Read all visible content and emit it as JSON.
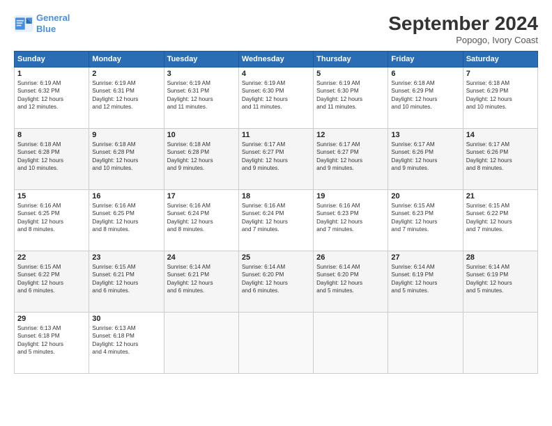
{
  "header": {
    "logo_line1": "General",
    "logo_line2": "Blue",
    "month": "September 2024",
    "location": "Popogo, Ivory Coast"
  },
  "weekdays": [
    "Sunday",
    "Monday",
    "Tuesday",
    "Wednesday",
    "Thursday",
    "Friday",
    "Saturday"
  ],
  "weeks": [
    [
      {
        "day": "1",
        "lines": [
          "Sunrise: 6:19 AM",
          "Sunset: 6:32 PM",
          "Daylight: 12 hours",
          "and 12 minutes."
        ]
      },
      {
        "day": "2",
        "lines": [
          "Sunrise: 6:19 AM",
          "Sunset: 6:31 PM",
          "Daylight: 12 hours",
          "and 12 minutes."
        ]
      },
      {
        "day": "3",
        "lines": [
          "Sunrise: 6:19 AM",
          "Sunset: 6:31 PM",
          "Daylight: 12 hours",
          "and 11 minutes."
        ]
      },
      {
        "day": "4",
        "lines": [
          "Sunrise: 6:19 AM",
          "Sunset: 6:30 PM",
          "Daylight: 12 hours",
          "and 11 minutes."
        ]
      },
      {
        "day": "5",
        "lines": [
          "Sunrise: 6:19 AM",
          "Sunset: 6:30 PM",
          "Daylight: 12 hours",
          "and 11 minutes."
        ]
      },
      {
        "day": "6",
        "lines": [
          "Sunrise: 6:18 AM",
          "Sunset: 6:29 PM",
          "Daylight: 12 hours",
          "and 10 minutes."
        ]
      },
      {
        "day": "7",
        "lines": [
          "Sunrise: 6:18 AM",
          "Sunset: 6:29 PM",
          "Daylight: 12 hours",
          "and 10 minutes."
        ]
      }
    ],
    [
      {
        "day": "8",
        "lines": [
          "Sunrise: 6:18 AM",
          "Sunset: 6:28 PM",
          "Daylight: 12 hours",
          "and 10 minutes."
        ]
      },
      {
        "day": "9",
        "lines": [
          "Sunrise: 6:18 AM",
          "Sunset: 6:28 PM",
          "Daylight: 12 hours",
          "and 10 minutes."
        ]
      },
      {
        "day": "10",
        "lines": [
          "Sunrise: 6:18 AM",
          "Sunset: 6:28 PM",
          "Daylight: 12 hours",
          "and 9 minutes."
        ]
      },
      {
        "day": "11",
        "lines": [
          "Sunrise: 6:17 AM",
          "Sunset: 6:27 PM",
          "Daylight: 12 hours",
          "and 9 minutes."
        ]
      },
      {
        "day": "12",
        "lines": [
          "Sunrise: 6:17 AM",
          "Sunset: 6:27 PM",
          "Daylight: 12 hours",
          "and 9 minutes."
        ]
      },
      {
        "day": "13",
        "lines": [
          "Sunrise: 6:17 AM",
          "Sunset: 6:26 PM",
          "Daylight: 12 hours",
          "and 9 minutes."
        ]
      },
      {
        "day": "14",
        "lines": [
          "Sunrise: 6:17 AM",
          "Sunset: 6:26 PM",
          "Daylight: 12 hours",
          "and 8 minutes."
        ]
      }
    ],
    [
      {
        "day": "15",
        "lines": [
          "Sunrise: 6:16 AM",
          "Sunset: 6:25 PM",
          "Daylight: 12 hours",
          "and 8 minutes."
        ]
      },
      {
        "day": "16",
        "lines": [
          "Sunrise: 6:16 AM",
          "Sunset: 6:25 PM",
          "Daylight: 12 hours",
          "and 8 minutes."
        ]
      },
      {
        "day": "17",
        "lines": [
          "Sunrise: 6:16 AM",
          "Sunset: 6:24 PM",
          "Daylight: 12 hours",
          "and 8 minutes."
        ]
      },
      {
        "day": "18",
        "lines": [
          "Sunrise: 6:16 AM",
          "Sunset: 6:24 PM",
          "Daylight: 12 hours",
          "and 7 minutes."
        ]
      },
      {
        "day": "19",
        "lines": [
          "Sunrise: 6:16 AM",
          "Sunset: 6:23 PM",
          "Daylight: 12 hours",
          "and 7 minutes."
        ]
      },
      {
        "day": "20",
        "lines": [
          "Sunrise: 6:15 AM",
          "Sunset: 6:23 PM",
          "Daylight: 12 hours",
          "and 7 minutes."
        ]
      },
      {
        "day": "21",
        "lines": [
          "Sunrise: 6:15 AM",
          "Sunset: 6:22 PM",
          "Daylight: 12 hours",
          "and 7 minutes."
        ]
      }
    ],
    [
      {
        "day": "22",
        "lines": [
          "Sunrise: 6:15 AM",
          "Sunset: 6:22 PM",
          "Daylight: 12 hours",
          "and 6 minutes."
        ]
      },
      {
        "day": "23",
        "lines": [
          "Sunrise: 6:15 AM",
          "Sunset: 6:21 PM",
          "Daylight: 12 hours",
          "and 6 minutes."
        ]
      },
      {
        "day": "24",
        "lines": [
          "Sunrise: 6:14 AM",
          "Sunset: 6:21 PM",
          "Daylight: 12 hours",
          "and 6 minutes."
        ]
      },
      {
        "day": "25",
        "lines": [
          "Sunrise: 6:14 AM",
          "Sunset: 6:20 PM",
          "Daylight: 12 hours",
          "and 6 minutes."
        ]
      },
      {
        "day": "26",
        "lines": [
          "Sunrise: 6:14 AM",
          "Sunset: 6:20 PM",
          "Daylight: 12 hours",
          "and 5 minutes."
        ]
      },
      {
        "day": "27",
        "lines": [
          "Sunrise: 6:14 AM",
          "Sunset: 6:19 PM",
          "Daylight: 12 hours",
          "and 5 minutes."
        ]
      },
      {
        "day": "28",
        "lines": [
          "Sunrise: 6:14 AM",
          "Sunset: 6:19 PM",
          "Daylight: 12 hours",
          "and 5 minutes."
        ]
      }
    ],
    [
      {
        "day": "29",
        "lines": [
          "Sunrise: 6:13 AM",
          "Sunset: 6:18 PM",
          "Daylight: 12 hours",
          "and 5 minutes."
        ]
      },
      {
        "day": "30",
        "lines": [
          "Sunrise: 6:13 AM",
          "Sunset: 6:18 PM",
          "Daylight: 12 hours",
          "and 4 minutes."
        ]
      },
      {
        "day": "",
        "lines": []
      },
      {
        "day": "",
        "lines": []
      },
      {
        "day": "",
        "lines": []
      },
      {
        "day": "",
        "lines": []
      },
      {
        "day": "",
        "lines": []
      }
    ]
  ]
}
